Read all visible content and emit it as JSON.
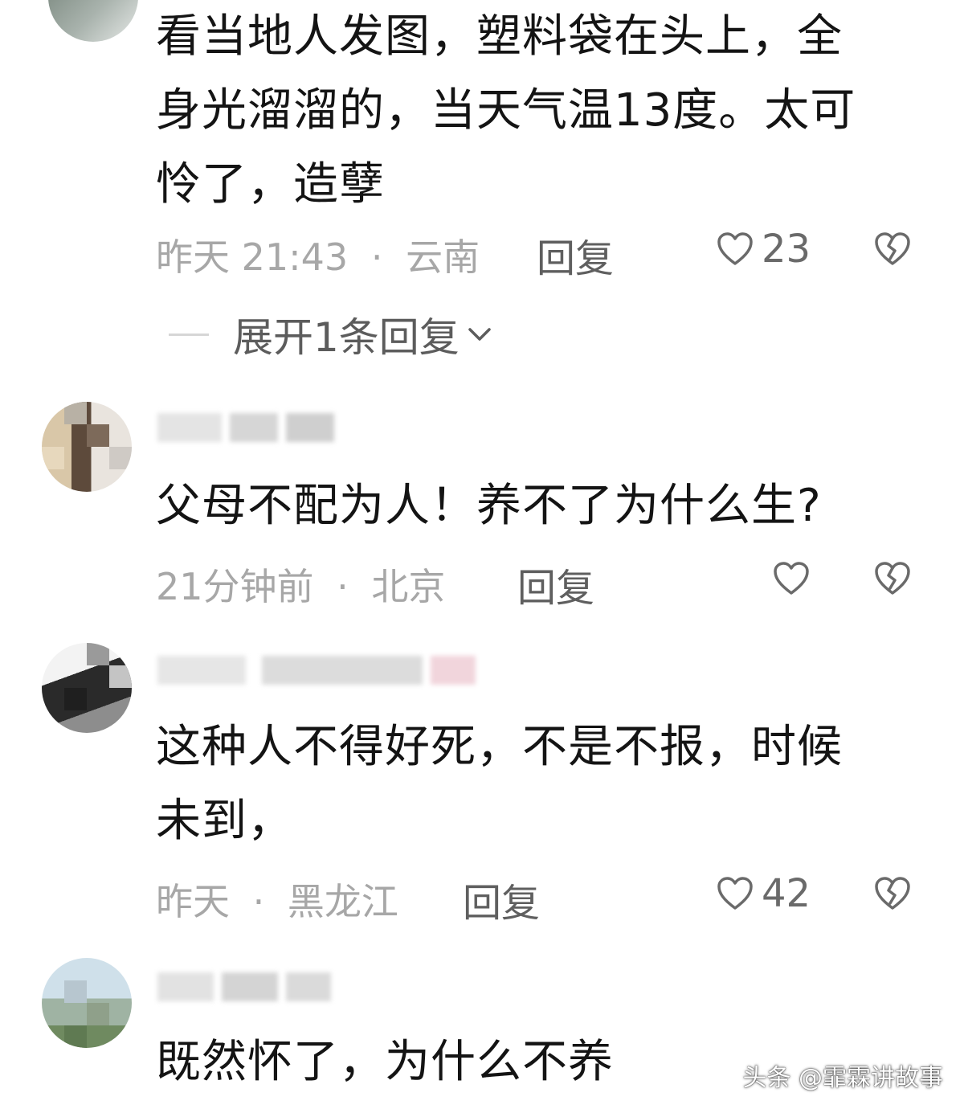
{
  "comments": [
    {
      "text_lines": [
        "看当地人发图，塑料袋在头上，全",
        "身光溜溜的，当天气温13度。太可",
        "怜了，造孽"
      ],
      "time": "昨天 21:43",
      "separator": "·",
      "location": "云南",
      "reply_label": "回复",
      "like_count": "23",
      "expand_label": "展开1条回复"
    },
    {
      "text_lines": [
        "父母不配为人！养不了为什么生?"
      ],
      "time": "21分钟前",
      "separator": "·",
      "location": "北京",
      "reply_label": "回复",
      "like_count": ""
    },
    {
      "text_lines": [
        "这种人不得好死，不是不报，时候",
        "未到，"
      ],
      "time": "昨天",
      "separator": "·",
      "location": "黑龙江",
      "reply_label": "回复",
      "like_count": "42"
    },
    {
      "text_lines": [
        "既然怀了，为什么不养"
      ]
    }
  ],
  "watermark": "头条 @霏霖讲故事",
  "icons": {
    "like": "heart-icon",
    "dislike": "broken-heart-icon",
    "expand": "chevron-down-icon"
  },
  "colors": {
    "text": "#141414",
    "meta": "#a7a7a7",
    "reply": "#5f5f5f"
  }
}
